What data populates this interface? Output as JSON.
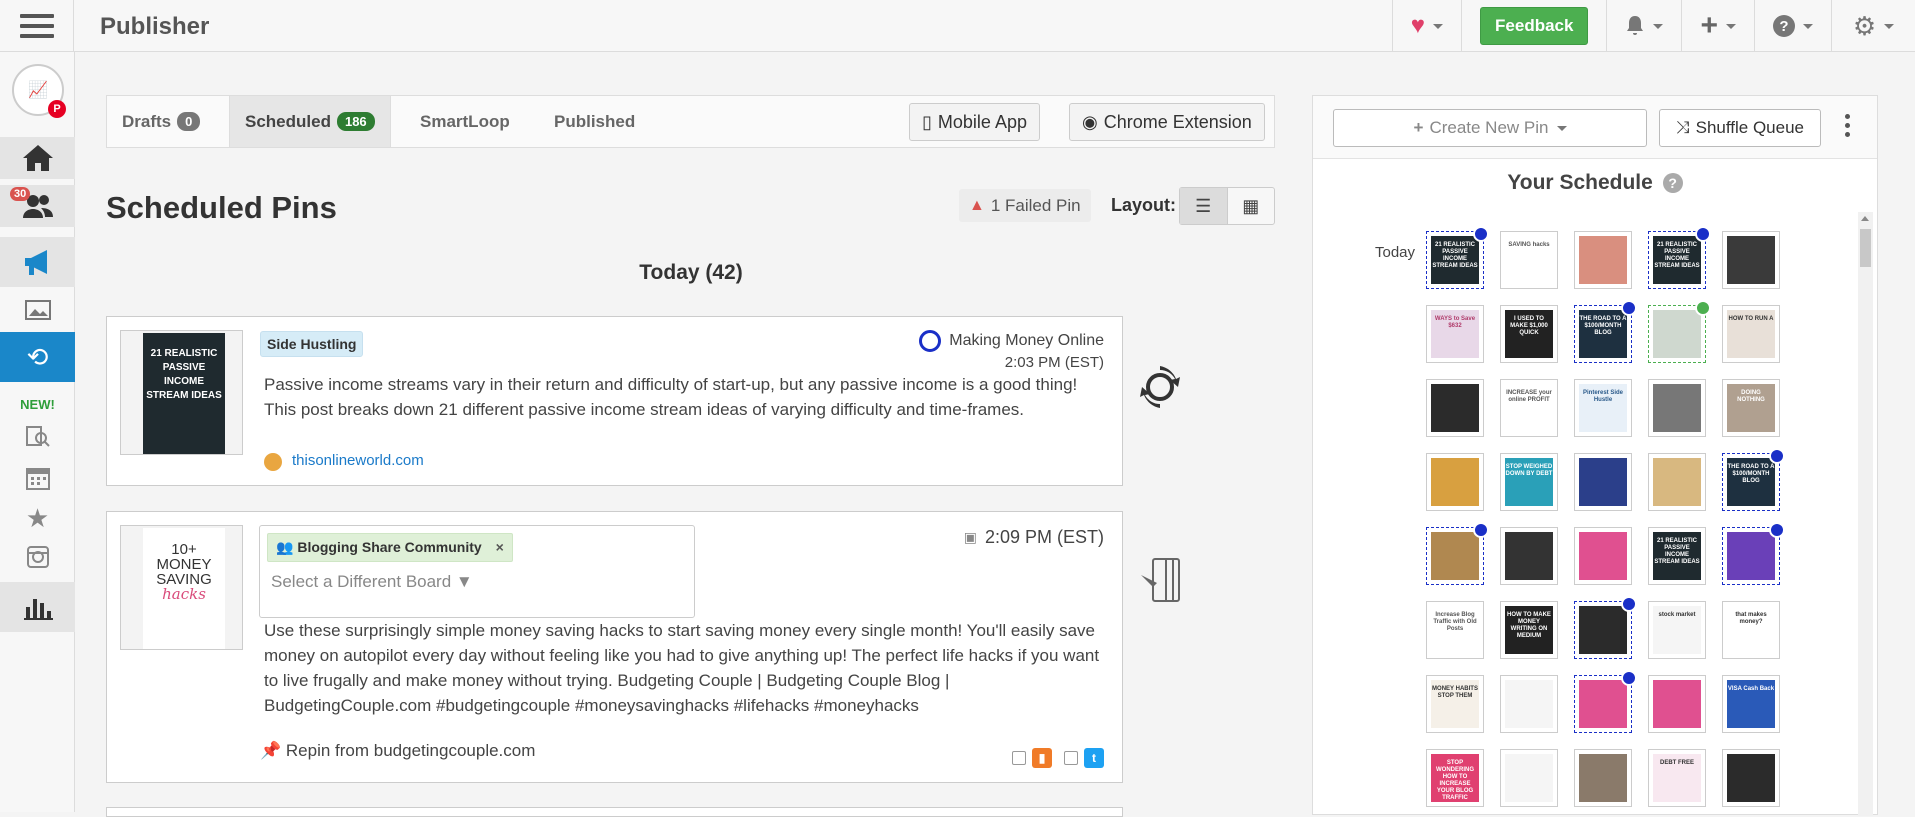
{
  "header": {
    "title": "Publisher",
    "feedback_label": "Feedback"
  },
  "sidebar": {
    "notification_count": "30",
    "new_label": "NEW!"
  },
  "tabs": [
    {
      "label": "Drafts",
      "count": "0"
    },
    {
      "label": "Scheduled",
      "count": "186"
    },
    {
      "label": "SmartLoop"
    },
    {
      "label": "Published"
    }
  ],
  "toolbar": {
    "mobile_app": "Mobile App",
    "chrome_extension": "Chrome Extension"
  },
  "main": {
    "title": "Scheduled Pins",
    "failed_pin": "1 Failed Pin",
    "layout_label": "Layout:",
    "day_heading": "Today (42)"
  },
  "pins": [
    {
      "thumb_text": "21 REALISTIC PASSIVE INCOME STREAM IDEAS",
      "board": "Side Hustling",
      "loop_board": "Making Money Online",
      "time": "2:03 PM (EST)",
      "description": "Passive income streams vary in their return and difficulty of start-up, but any passive income is a good thing! This post breaks down 21 different passive income stream ideas of varying difficulty and time-frames.",
      "source": "thisonlineworld.com"
    },
    {
      "thumb_title": "10+ MONEY SAVING",
      "thumb_script": "hacks",
      "board": "Blogging Share Community",
      "board_close": "×",
      "board_placeholder": "Select a Different Board ▼",
      "time": "2:09 PM (EST)",
      "description": "Use these surprisingly simple money saving hacks to start saving money every single month! You'll easily save money on autopilot every day without feeling like you had to give anything  up! The perfect life hacks if you want to live frugally and make money without trying. Budgeting Couple | Budgeting Couple Blog | BudgetingCouple.com #budgetingcouple #moneysavinghacks #lifehacks #moneyhacks",
      "repin": "Repin from budgetingcouple.com"
    }
  ],
  "schedule": {
    "create_pin": "Create New Pin",
    "shuffle": "Shuffle Queue",
    "title": "Your Schedule",
    "today_label": "Today",
    "rows": [
      [
        {
          "text": "21 REALISTIC PASSIVE INCOME STREAM IDEAS",
          "bg": "#1f2a2f",
          "fg": "#ffffff",
          "dash": "blue",
          "loop": true
        },
        {
          "text": "SAVING hacks",
          "bg": "#ffffff",
          "fg": "#555555"
        },
        {
          "text": "",
          "bg": "#d98f7f",
          "fg": "#ffffff"
        },
        {
          "text": "21 REALISTIC PASSIVE INCOME STREAM IDEAS",
          "bg": "#1f2a2f",
          "fg": "#ffffff",
          "dash": "blue",
          "loop": true
        },
        {
          "text": "",
          "bg": "#3a3a3a",
          "fg": "#ffffff"
        }
      ],
      [
        {
          "text": "WAYS to Save $632",
          "bg": "#e8d8e8",
          "fg": "#b03a6a"
        },
        {
          "text": "I USED TO MAKE $1,000 QUICK",
          "bg": "#222222",
          "fg": "#ffffff"
        },
        {
          "text": "THE ROAD TO A $100/MONTH BLOG",
          "bg": "#1e3040",
          "fg": "#ffffff",
          "dash": "blue",
          "loop": true
        },
        {
          "text": "",
          "bg": "#cfd8cf",
          "fg": "#333333",
          "dash": "green",
          "loop_green": true
        },
        {
          "text": "HOW TO RUN A",
          "bg": "#e8e0d8",
          "fg": "#333333"
        }
      ],
      [
        {
          "text": "",
          "bg": "#2b2b2b",
          "fg": "#ffffff"
        },
        {
          "text": "INCREASE your online PROFIT",
          "bg": "#ffffff",
          "fg": "#555555"
        },
        {
          "text": "Pinterest Side Hustle",
          "bg": "#e8f0f8",
          "fg": "#2a5a8a"
        },
        {
          "text": "",
          "bg": "#777777",
          "fg": "#ffffff"
        },
        {
          "text": "DOING NOTHING",
          "bg": "#b0a090",
          "fg": "#ffffff"
        }
      ],
      [
        {
          "text": "",
          "bg": "#d8a040",
          "fg": "#ffffff"
        },
        {
          "text": "STOP WEIGHED DOWN BY DEBT",
          "bg": "#2aa0b8",
          "fg": "#ffffff"
        },
        {
          "text": "",
          "bg": "#2b3f8a",
          "fg": "#ffffff"
        },
        {
          "text": "",
          "bg": "#d8b880",
          "fg": "#ffffff"
        },
        {
          "text": "THE ROAD TO A $100/MONTH BLOG",
          "bg": "#1e3040",
          "fg": "#ffffff",
          "dash": "blue",
          "loop": true
        }
      ],
      [
        {
          "text": "",
          "bg": "#b08850",
          "fg": "#ffffff",
          "dash": "blue",
          "loop": true
        },
        {
          "text": "",
          "bg": "#333333",
          "fg": "#ffffff"
        },
        {
          "text": "",
          "bg": "#e05090",
          "fg": "#ffffff"
        },
        {
          "text": "21 REALISTIC PASSIVE INCOME STREAM IDEAS",
          "bg": "#1f2a2f",
          "fg": "#ffffff"
        },
        {
          "text": "",
          "bg": "#6a40b8",
          "fg": "#ffffff",
          "dash": "blue",
          "loop": true
        }
      ],
      [
        {
          "text": "Increase Blog Traffic with Old Posts",
          "bg": "#ffffff",
          "fg": "#555555"
        },
        {
          "text": "HOW TO MAKE MONEY WRITING ON MEDIUM",
          "bg": "#222222",
          "fg": "#ffffff"
        },
        {
          "text": "",
          "bg": "#2b2b2b",
          "fg": "#ffffff",
          "dash": "blue",
          "loop": true
        },
        {
          "text": "stock market",
          "bg": "#f5f5f5",
          "fg": "#333333"
        },
        {
          "text": "that makes money?",
          "bg": "#ffffff",
          "fg": "#333333"
        }
      ],
      [
        {
          "text": "MONEY HABITS STOP THEM",
          "bg": "#f5f0e8",
          "fg": "#333333"
        },
        {
          "text": "",
          "bg": "#f5f5f5",
          "fg": "#333333"
        },
        {
          "text": "",
          "bg": "#e05090",
          "fg": "#ffffff",
          "dash": "blue",
          "loop": true
        },
        {
          "text": "",
          "bg": "#e05090",
          "fg": "#ffffff"
        },
        {
          "text": "VISA Cash Back",
          "bg": "#2a5ab8",
          "fg": "#ffffff"
        }
      ],
      [
        {
          "text": "STOP WONDERING HOW TO INCREASE YOUR BLOG TRAFFIC",
          "bg": "#e04070",
          "fg": "#ffffff"
        },
        {
          "text": "",
          "bg": "#f5f5f5",
          "fg": "#333333"
        },
        {
          "text": "",
          "bg": "#8a7a6a",
          "fg": "#ffffff"
        },
        {
          "text": "DEBT FREE",
          "bg": "#f8e8f0",
          "fg": "#333333"
        },
        {
          "text": "",
          "bg": "#2b2b2b",
          "fg": "#ffffff"
        }
      ]
    ]
  }
}
